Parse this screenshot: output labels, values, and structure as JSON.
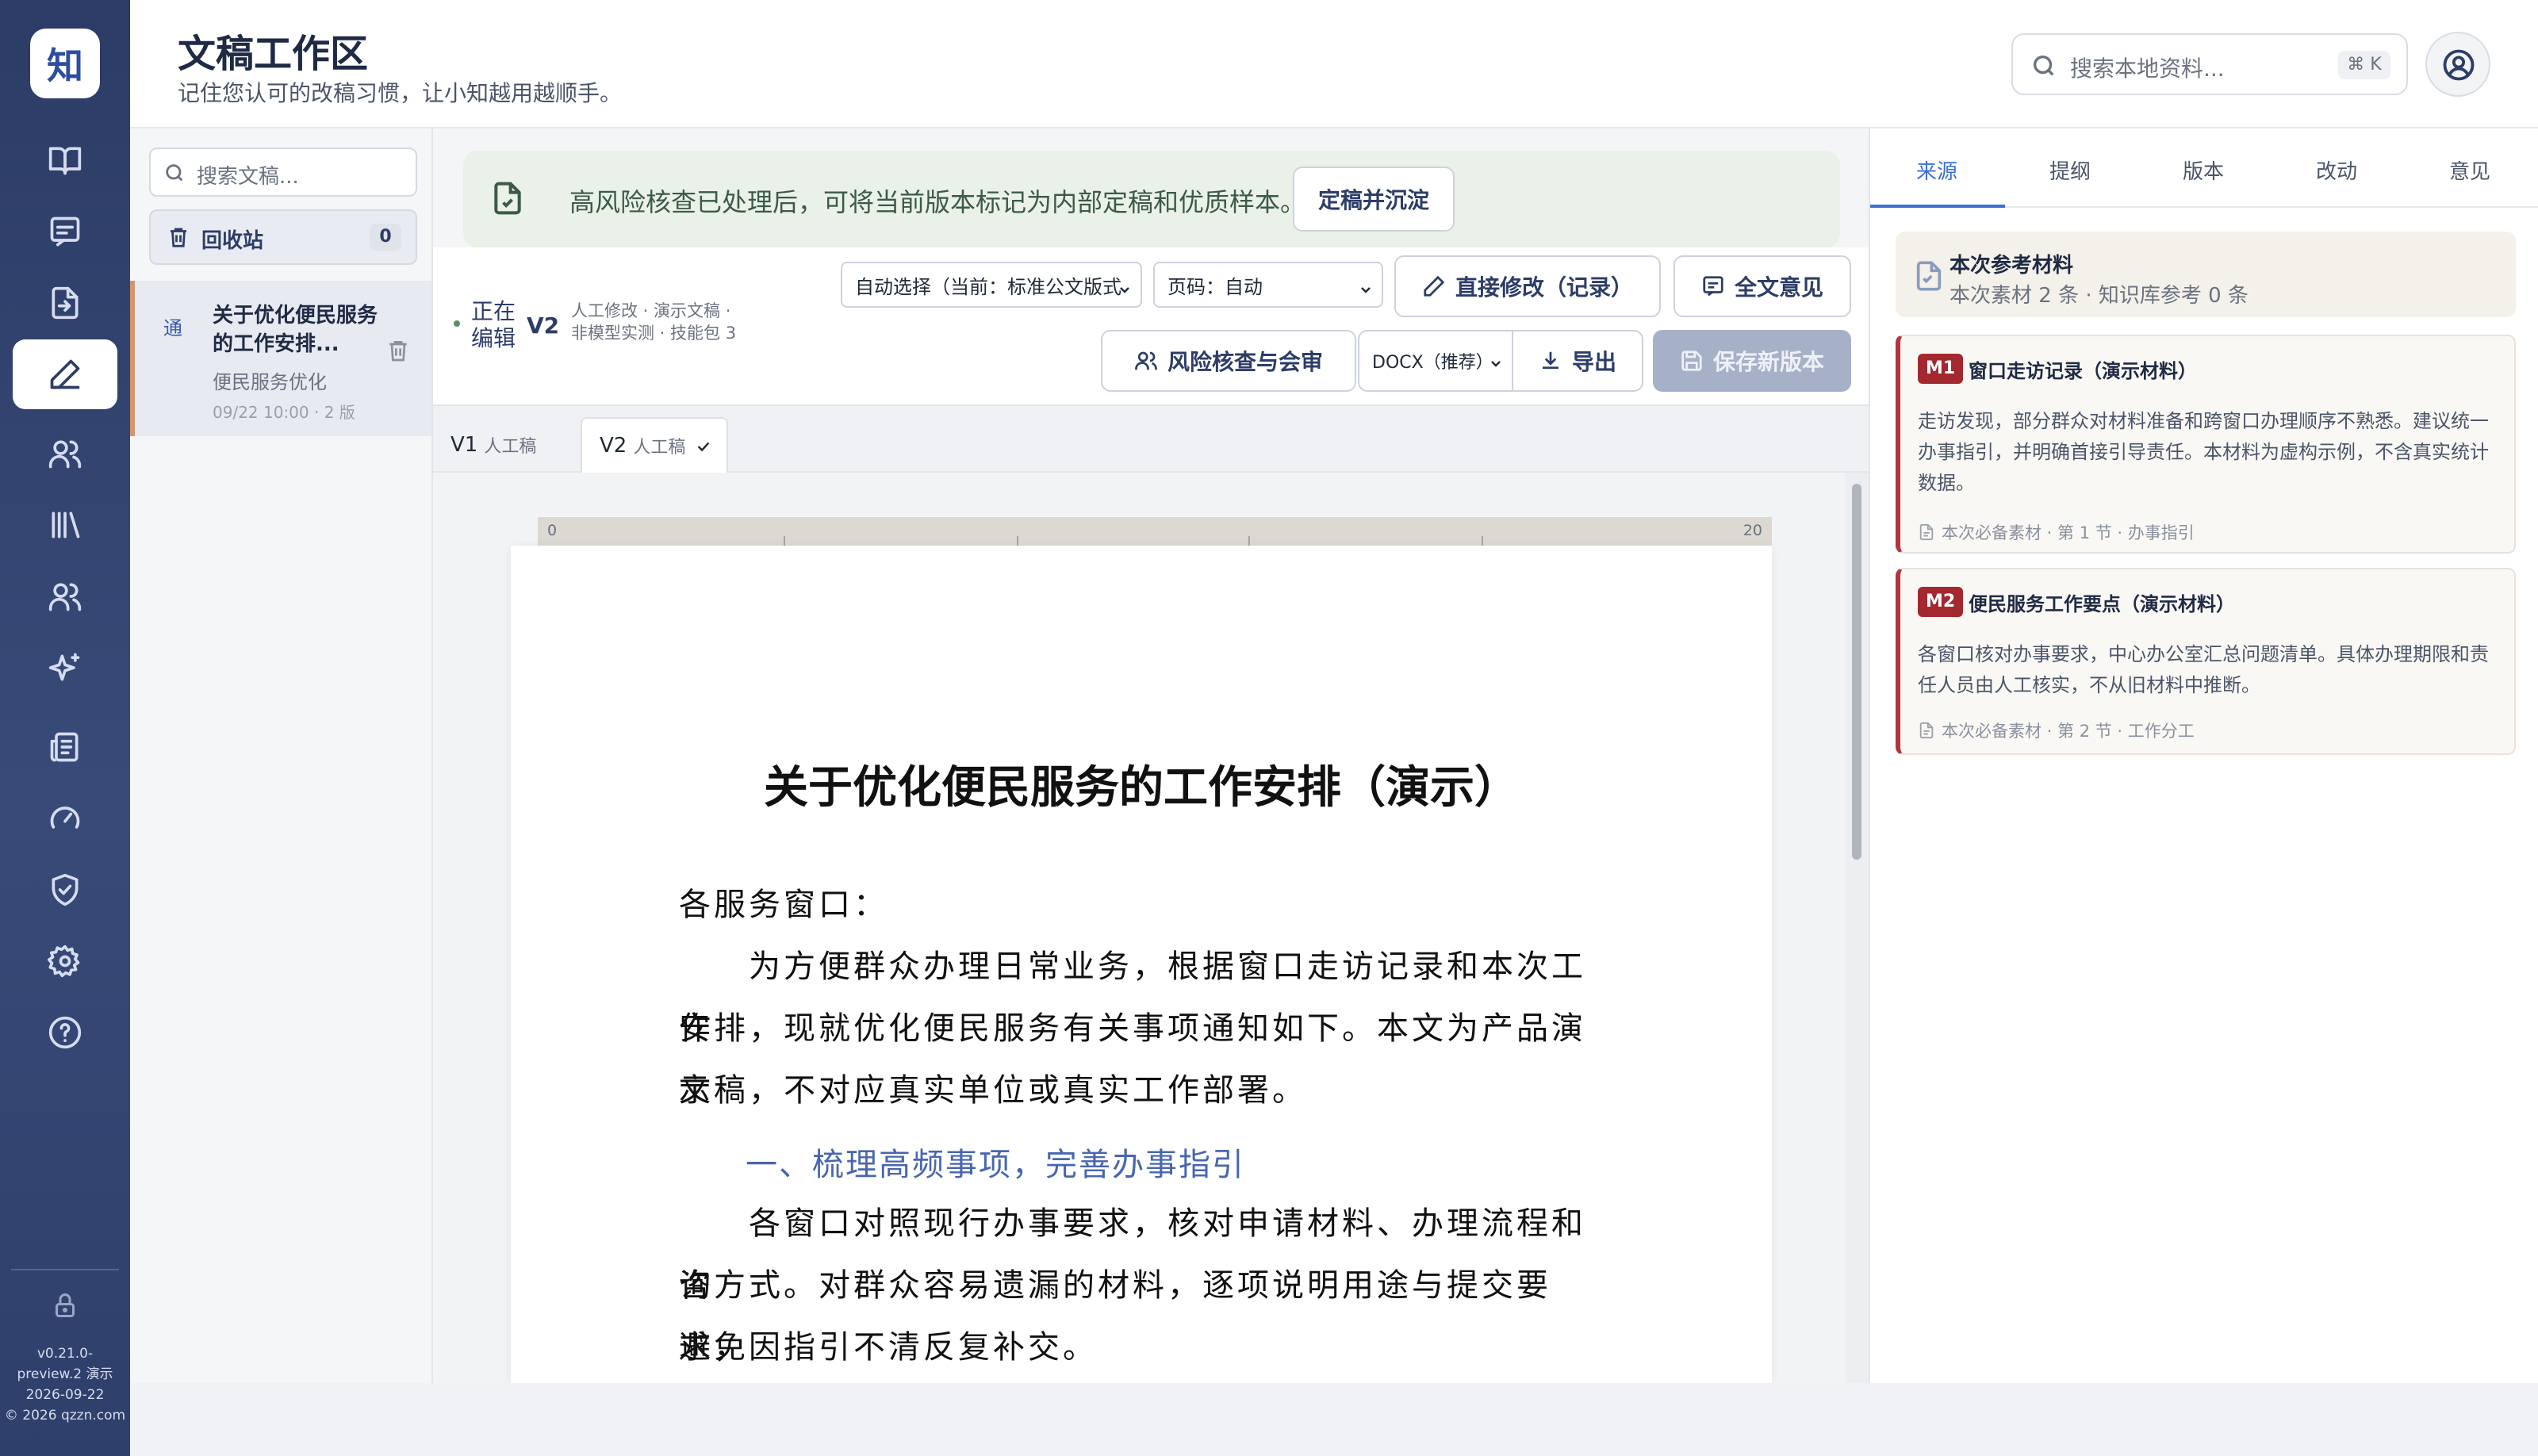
{
  "app": {
    "logo_char": "知",
    "title": "文稿工作区",
    "subtitle": "记住您认可的改稿习惯，让小知越用越顺手。",
    "version_line1": "v0.21.0-",
    "version_line2": "preview.2 演示",
    "version_date": "2026-09-22",
    "copyright": "© 2026 qzzn.com"
  },
  "header": {
    "search_placeholder": "搜索本地资料...",
    "search_shortcut": "⌘ K"
  },
  "nav": [
    {
      "icon": "book-open-icon",
      "active": false
    },
    {
      "icon": "message-icon",
      "active": false
    },
    {
      "icon": "file-import-icon",
      "active": false
    },
    {
      "icon": "pen-icon",
      "active": true
    },
    {
      "icon": "users-icon",
      "active": false
    },
    {
      "icon": "library-icon",
      "active": false
    },
    {
      "icon": "team-icon",
      "active": false
    },
    {
      "icon": "sparkles-icon",
      "active": false
    },
    {
      "icon": "report-icon",
      "active": false
    },
    {
      "icon": "gauge-icon",
      "active": false
    },
    {
      "icon": "shield-check-icon",
      "active": false
    },
    {
      "icon": "gear-icon",
      "active": false
    },
    {
      "icon": "help-icon",
      "active": false
    }
  ],
  "doclist": {
    "search_placeholder": "搜索文稿...",
    "trash_label": "回收站",
    "trash_count": "0",
    "item": {
      "type_badge": "通",
      "title": "关于优化便民服务的工作安排...",
      "category": "便民服务优化",
      "meta": "09/22 10:00 · 2 版"
    }
  },
  "notice": {
    "text": "高风险核查已处理后，可将当前版本标记为内部定稿和优质样本。",
    "button": "定稿并沉淀"
  },
  "toolbar": {
    "editing_label_1": "正在",
    "editing_label_2": "编辑",
    "version": "V2",
    "version_meta_1": "人工修改 · 演示文稿 ·",
    "version_meta_2": "非模型实测 · 技能包 3",
    "format_select": "自动选择（当前：标准公文版式",
    "page_select": "页码：自动",
    "direct_edit": "直接修改（记录）",
    "full_review": "全文意见",
    "risk_review": "风险核查与会审",
    "export_format": "DOCX（推荐）",
    "export": "导出",
    "save_version": "保存新版本"
  },
  "version_tabs": [
    {
      "label": "V1",
      "sub": "人工稿",
      "active": false
    },
    {
      "label": "V2",
      "sub": "人工稿",
      "active": true
    }
  ],
  "ruler": {
    "start": "0",
    "end": "20"
  },
  "document": {
    "title": "关于优化便民服务的工作安排（演示）",
    "salutation": "各服务窗口：",
    "para1_line1": "　　为方便群众办理日常业务，根据窗口走访记录和本次工作",
    "para1_line2": "安排，现就优化便民服务有关事项通知如下。本文为产品演示",
    "para1_line3": "文稿，不对应真实单位或真实工作部署。",
    "heading1": "一、梳理高频事项，完善办事指引",
    "para2_line1": "　　各窗口对照现行办事要求，核对申请材料、办理流程和咨",
    "para2_line2": "询方式。对群众容易遗漏的材料，逐项说明用途与提交要求，",
    "para2_line3": "避免因指引不清反复补交。"
  },
  "right_panel": {
    "tabs": [
      "来源",
      "提纲",
      "版本",
      "改动",
      "意见"
    ],
    "active_tab": "来源",
    "ref_title": "本次参考材料",
    "ref_summary": "本次素材 2 条 · 知识库参考 0 条",
    "materials": [
      {
        "badge": "M1",
        "title": "窗口走访记录（演示材料）",
        "body": "走访发现，部分群众对材料准备和跨窗口办理顺序不熟悉。建议统一办事指引，并明确首接引导责任。本材料为虚构示例，不含真实统计数据。",
        "footer": "本次必备素材 · 第 1 节 · 办事指引"
      },
      {
        "badge": "M2",
        "title": "便民服务工作要点（演示材料）",
        "body": "各窗口核对办事要求，中心办公室汇总问题清单。具体办理期限和责任人员由人工核实，不从旧材料中推断。",
        "footer": "本次必备素材 · 第 2 节 · 工作分工"
      }
    ]
  },
  "colors": {
    "rail": "#2c3c66",
    "accent": "#3b6fd6",
    "badge_red": "#a3282f",
    "notice_bg": "#e9f1e8",
    "heading_blue": "#4866b0"
  }
}
